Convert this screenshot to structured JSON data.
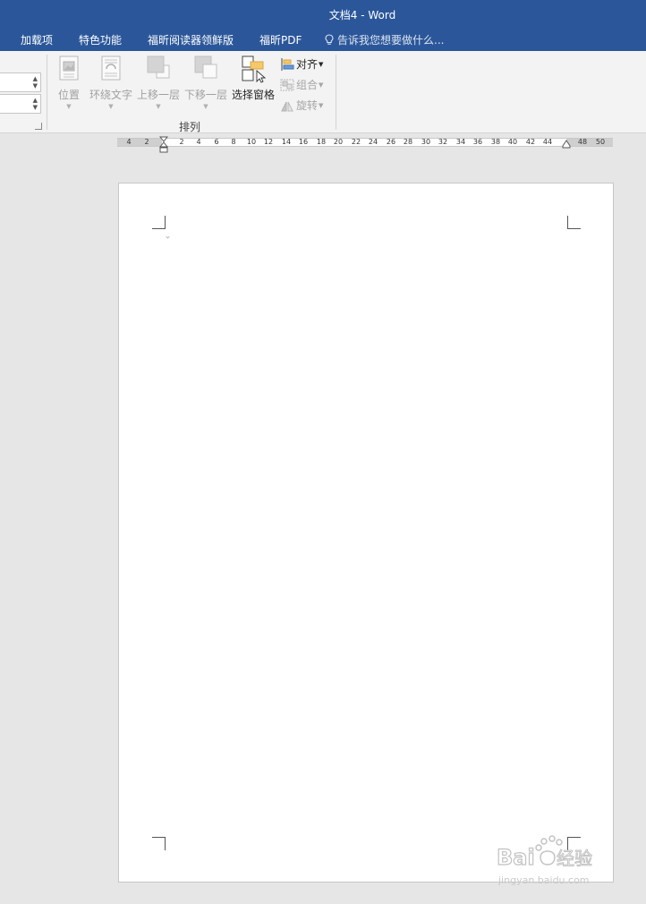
{
  "window": {
    "title": "文档4 - Word"
  },
  "tabs": [
    {
      "label": "加载项"
    },
    {
      "label": "特色功能"
    },
    {
      "label": "福昕阅读器领鲜版"
    },
    {
      "label": "福昕PDF"
    }
  ],
  "tell_me": {
    "placeholder": "告诉我您想要做什么..."
  },
  "ribbon": {
    "buttons": [
      {
        "label": "位置",
        "enabled": false,
        "has_dropdown": true
      },
      {
        "label": "环绕文字",
        "enabled": false,
        "has_dropdown": true
      },
      {
        "label": "上移一层",
        "enabled": false,
        "has_dropdown": true
      },
      {
        "label": "下移一层",
        "enabled": false,
        "has_dropdown": true
      },
      {
        "label": "选择窗格",
        "enabled": true,
        "has_dropdown": false
      }
    ],
    "small_buttons": [
      {
        "label": "对齐",
        "enabled": true
      },
      {
        "label": "组合",
        "enabled": false
      },
      {
        "label": "旋转",
        "enabled": false
      }
    ],
    "group_label": "排列"
  },
  "ruler": {
    "ticks": [
      "4",
      "2",
      "2",
      "4",
      "6",
      "8",
      "10",
      "12",
      "14",
      "16",
      "18",
      "20",
      "22",
      "24",
      "26",
      "28",
      "30",
      "32",
      "34",
      "36",
      "38",
      "40",
      "42",
      "44",
      "48",
      "50"
    ]
  },
  "watermark": {
    "text": "Bai du 经验",
    "subtext": "jingyan.baidu.com"
  },
  "colors": {
    "title_bar": "#2b579a",
    "ribbon_bg": "#f3f3f3",
    "canvas_bg": "#e6e6e6",
    "accent_icon": "#f5c86b"
  }
}
